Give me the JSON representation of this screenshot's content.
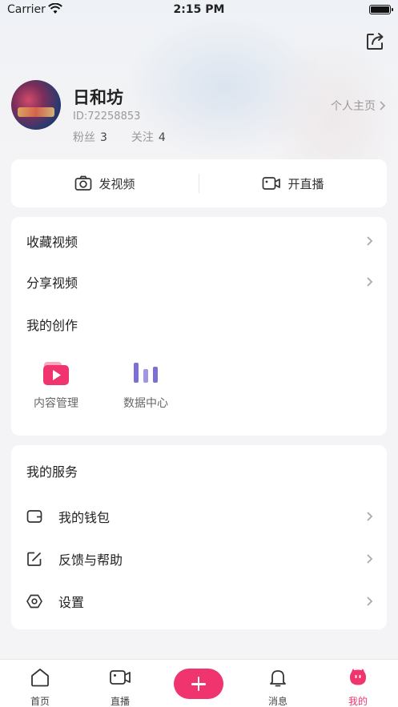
{
  "status_bar": {
    "carrier": "Carrier",
    "time": "2:15 PM"
  },
  "profile": {
    "name": "日和坊",
    "id": "ID:72258853",
    "fans_label": "粉丝",
    "fans_count": "3",
    "following_label": "关注",
    "following_count": "4",
    "homepage_link": "个人主页"
  },
  "quick_actions": {
    "post_video": "发视频",
    "go_live": "开直播"
  },
  "menu": {
    "favorites": "收藏视频",
    "shared": "分享视频",
    "creations_title": "我的创作",
    "content_manage": "内容管理",
    "data_center": "数据中心"
  },
  "services": {
    "title": "我的服务",
    "wallet": "我的钱包",
    "feedback": "反馈与帮助",
    "settings": "设置"
  },
  "tabbar": {
    "home": "首页",
    "live": "直播",
    "messages": "消息",
    "mine": "我的"
  },
  "colors": {
    "accent": "#f0356e",
    "data_icon": "#7b70d6"
  },
  "icons": [
    "share-icon",
    "camera-icon",
    "video-camera-icon",
    "chevron-right-icon",
    "play-icon",
    "bar-chart-icon",
    "wallet-icon",
    "edit-icon",
    "gear-icon",
    "home-icon",
    "live-icon",
    "bell-icon",
    "mine-icon",
    "plus-icon"
  ]
}
